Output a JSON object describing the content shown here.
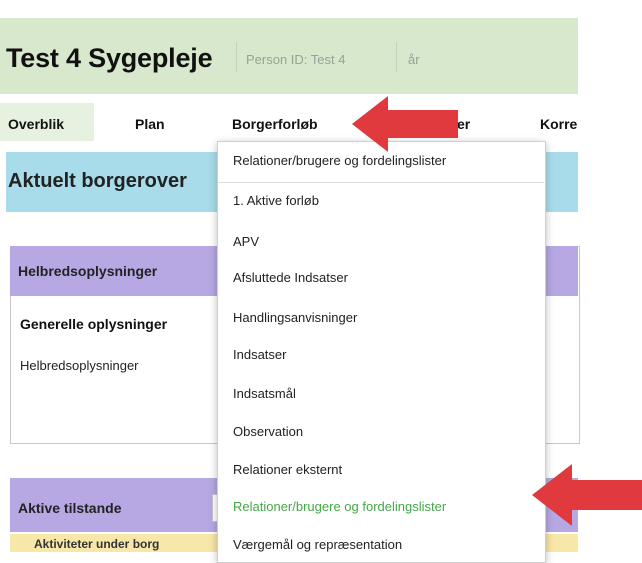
{
  "header": {
    "title": "Test 4 Sygepleje",
    "person_id": "Person ID: Test 4",
    "age": "år"
  },
  "nav": {
    "overblik": "Overblik",
    "plan": "Plan",
    "borgerforloeb": "Borgerforløb",
    "hidden_tab_suffix": "er",
    "korre": "Korre"
  },
  "banner": {
    "title": "Aktuelt borgerover"
  },
  "health_panel": {
    "title": "Helbredsoplysninger",
    "section_heading": "Generelle oplysninger",
    "section_text": "Helbredsoplysninger"
  },
  "conditions_panel": {
    "title": "Aktive tilstande",
    "row_text": "Aktiviteter under borg"
  },
  "dropdown": {
    "top_item": "Relationer/brugere og fordelingslister",
    "items": [
      "1. Aktive forløb",
      "APV",
      "Afsluttede Indsatser",
      "Handlingsanvisninger",
      "Indsatser",
      "Indsatsmål",
      "Observation",
      "Relationer eksternt",
      "Relationer/brugere og fordelingslister",
      "Værgemål og repræsentation"
    ],
    "highlighted_index": 8
  },
  "colors": {
    "header_bg": "#d7e8cc",
    "banner_bg": "#a9dcea",
    "panel_head_bg": "#b7a8e3",
    "highlight_text": "#45a847",
    "arrow_red": "#e0393e"
  },
  "icons": {
    "nav_arrow": "red-arrow-left-icon",
    "menu_arrow": "red-arrow-left-icon"
  }
}
